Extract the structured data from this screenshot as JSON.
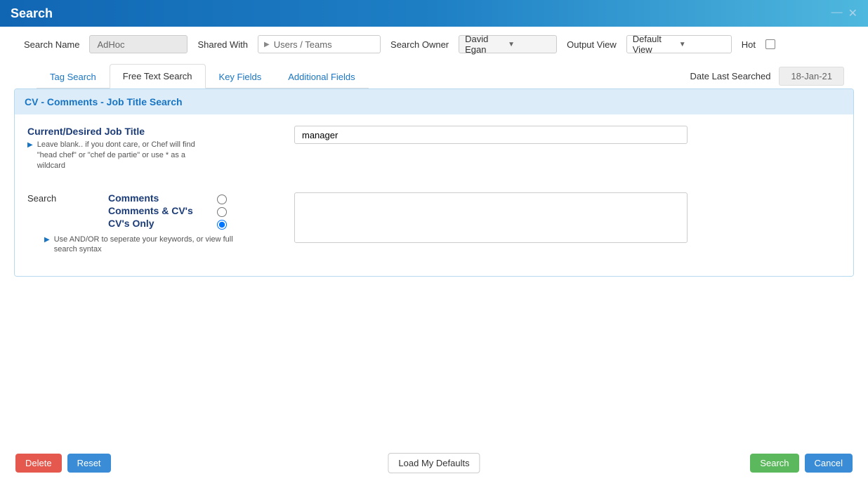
{
  "titlebar": {
    "title": "Search"
  },
  "top": {
    "search_name_label": "Search Name",
    "search_name_value": "AdHoc",
    "shared_with_label": "Shared With",
    "shared_with_value": "Users / Teams",
    "search_owner_label": "Search Owner",
    "search_owner_value": "David Egan",
    "output_view_label": "Output View",
    "output_view_value": "Default View",
    "hot_label": "Hot"
  },
  "tabs": {
    "tag_search": "Tag Search",
    "free_text_search": "Free Text Search",
    "key_fields": "Key Fields",
    "additional_fields": "Additional Fields"
  },
  "date": {
    "label": "Date Last Searched",
    "value": "18-Jan-21"
  },
  "panel": {
    "header": "CV - Comments - Job Title Search",
    "job_title_label": "Current/Desired Job Title",
    "job_title_help": "Leave blank.. if you dont care, or\nChef will find \"head chef\" or \"chef de partie\" or use * as a wildcard",
    "job_title_value": "manager",
    "search_label": "Search",
    "opt_comments": "Comments",
    "opt_comments_cvs": "Comments & CV's",
    "opt_cvs_only": "CV's Only",
    "search_help": "Use AND/OR to seperate your keywords, or view full search syntax",
    "search_textarea_value": ""
  },
  "footer": {
    "delete": "Delete",
    "reset": "Reset",
    "load_defaults": "Load My Defaults",
    "search": "Search",
    "cancel": "Cancel"
  }
}
